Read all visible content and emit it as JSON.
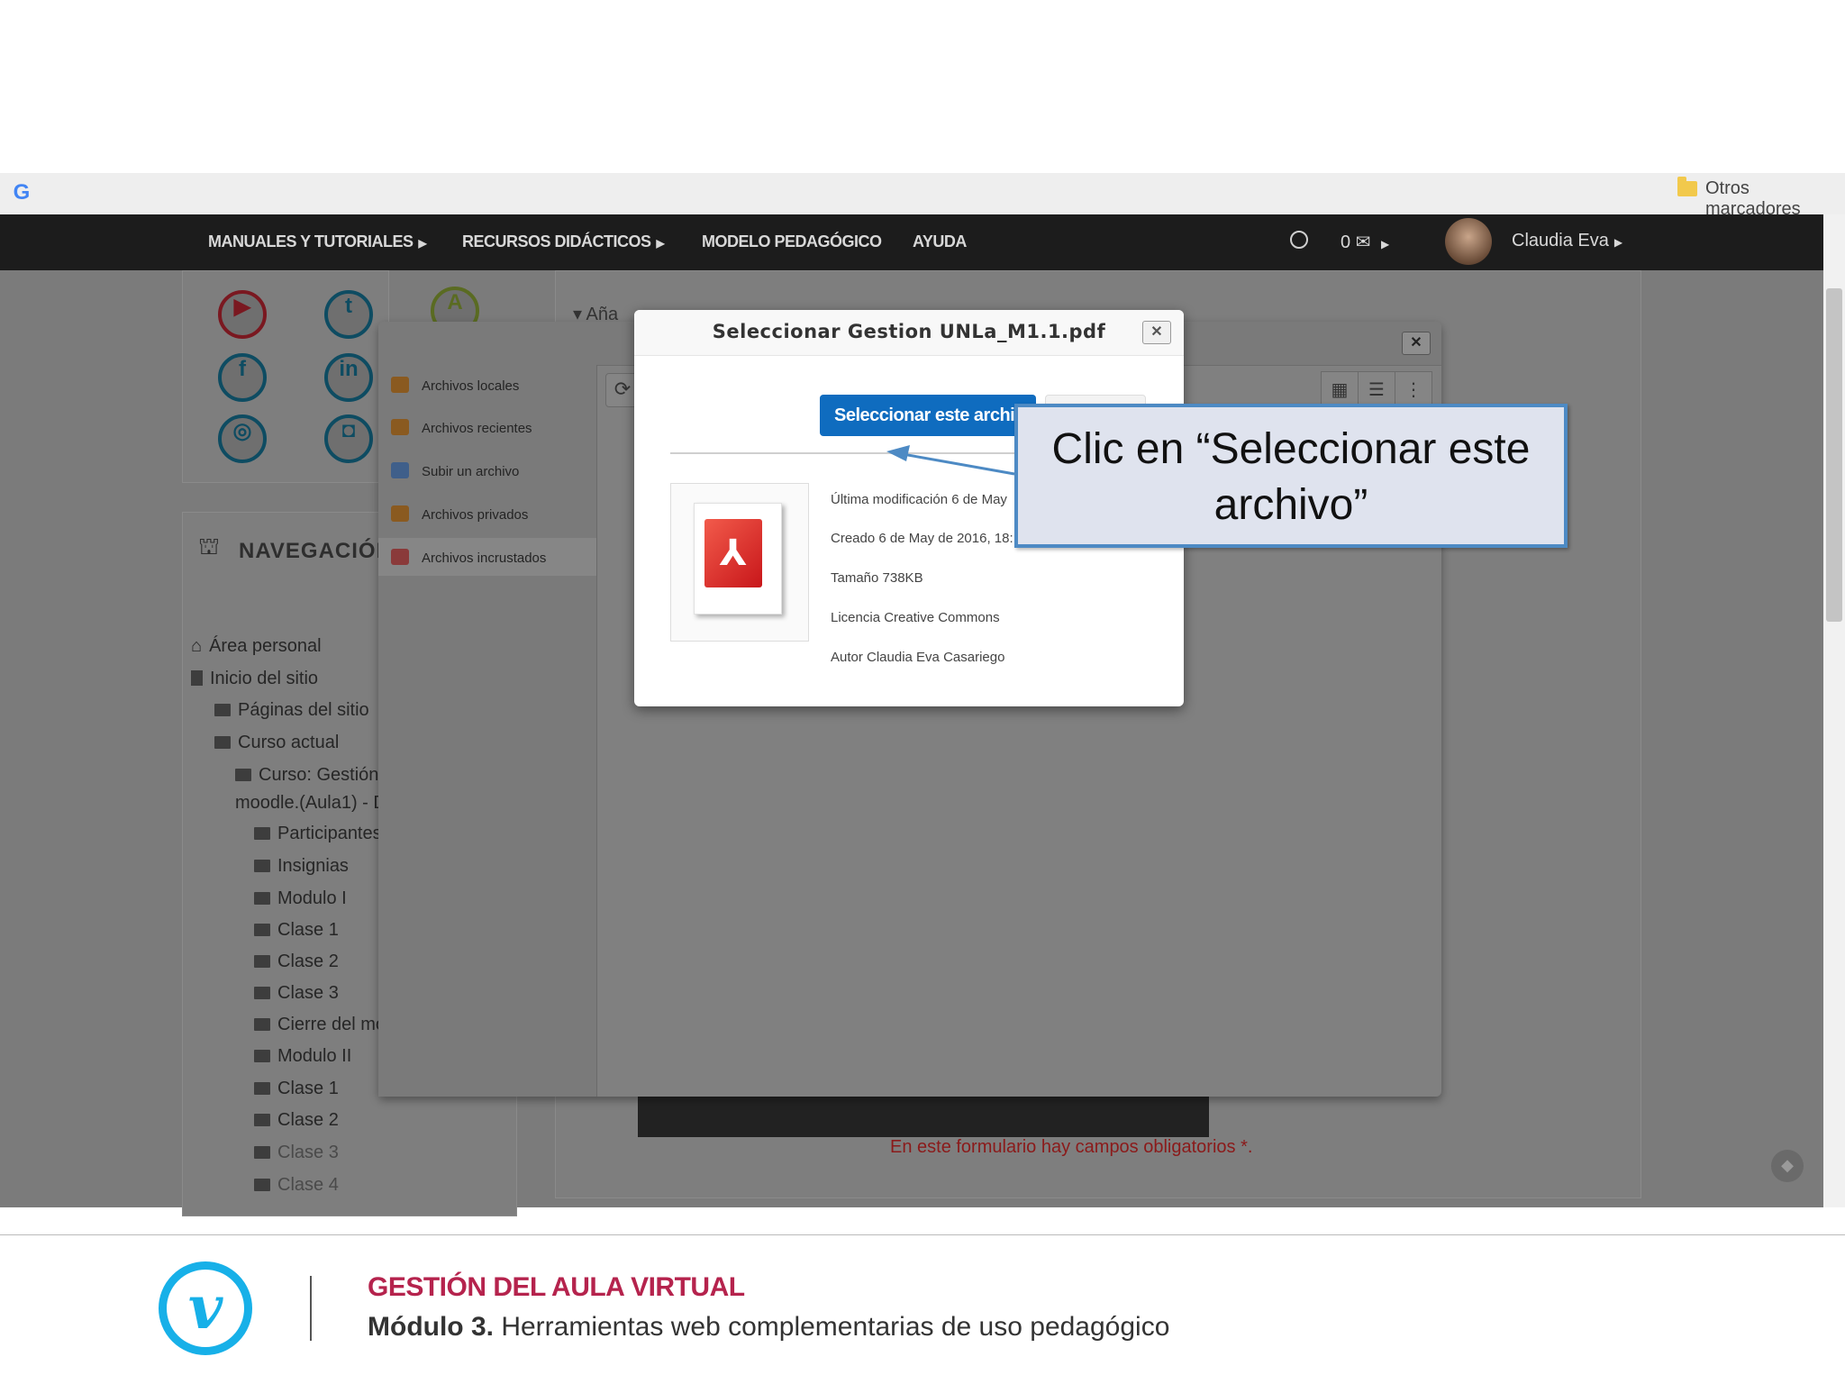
{
  "browser": {
    "google_icon": "G",
    "bookmarks_folder_label": "Otros marcadores"
  },
  "topnav": {
    "items": [
      "MANUALES Y TUTORIALES",
      "RECURSOS DIDÁCTICOS",
      "MODELO PEDAGÓGICO",
      "AYUDA"
    ],
    "messages_count": "0",
    "user_name": "Claudia Eva"
  },
  "social_blocks": [
    "youtube-icon",
    "twitter-icon",
    "a-icon",
    "facebook-icon",
    "linkedin-icon",
    "settings-circle-icon",
    "camera-icon"
  ],
  "navigation": {
    "title": "NAVEGACIÓN",
    "items": [
      {
        "label": "Área personal"
      },
      {
        "label": "Inicio del sitio"
      },
      {
        "label": "Páginas del sitio"
      },
      {
        "label": "Curso actual"
      },
      {
        "label": "Curso: Gestión"
      },
      {
        "label": "moodle.(Aula1) - D"
      },
      {
        "label": "Participantes"
      },
      {
        "label": "Insignias"
      },
      {
        "label": "Modulo I"
      },
      {
        "label": "Clase 1"
      },
      {
        "label": "Clase 2"
      },
      {
        "label": "Clase 3"
      },
      {
        "label": "Cierre del mó"
      },
      {
        "label": "Modulo II"
      },
      {
        "label": "Clase 1"
      },
      {
        "label": "Clase 2"
      },
      {
        "label": "Clase 3"
      },
      {
        "label": "Clase 4"
      }
    ]
  },
  "file_picker": {
    "partial_heading": "Aña",
    "repositories": [
      "Archivos locales",
      "Archivos recientes",
      "Subir un archivo",
      "Archivos privados",
      "Archivos incrustados"
    ]
  },
  "select_dialog": {
    "title": "Seleccionar Gestion UNLa_M1.1.pdf",
    "select_button": "Seleccionar este archivo",
    "meta": [
      "Última modificación  6 de May",
      "Creado  6 de May de 2016, 18:",
      "Tamaño  738KB",
      "Licencia  Creative Commons",
      "Autor  Claudia Eva Casariego"
    ]
  },
  "form_message": "En este formulario hay campos obligatorios *.",
  "callout": {
    "text": "Clic en “Seleccionar este archivo”"
  },
  "slide_footer": {
    "logo_letter": "v",
    "course_title": "GESTIÓN DEL AULA VIRTUAL",
    "module_label": "Módulo 3.",
    "module_text": " Herramientas web complementarias de uso pedagógico"
  },
  "colors": {
    "moodle_blue": "#0f6cbf",
    "callout_border": "#4d8ac4",
    "brand_cyan": "#17b0e8",
    "brand_magenta": "#b5234d"
  }
}
